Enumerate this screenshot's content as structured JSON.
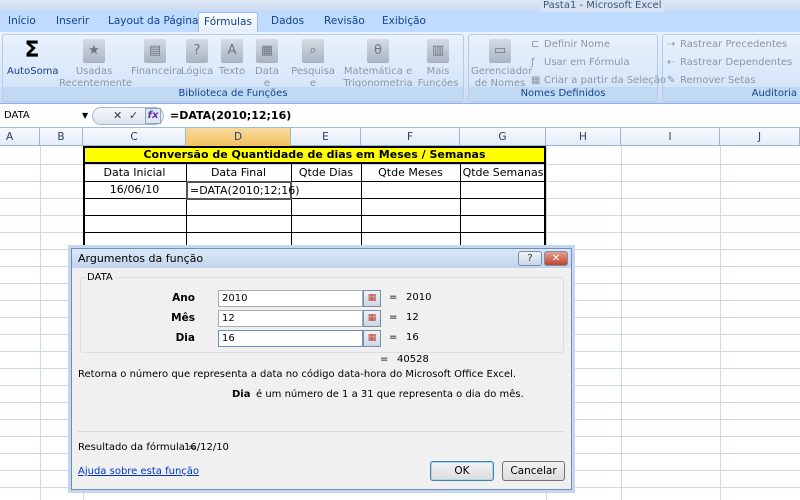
{
  "window": {
    "title": "Pasta1 - Microsoft Excel"
  },
  "tabs": [
    {
      "label": "Início"
    },
    {
      "label": "Inserir"
    },
    {
      "label": "Layout da Página"
    },
    {
      "label": "Fórmulas",
      "active": true
    },
    {
      "label": "Dados"
    },
    {
      "label": "Revisão"
    },
    {
      "label": "Exibição"
    }
  ],
  "ribbon": {
    "biblioteca": {
      "label": "Biblioteca de Funções",
      "buttons": [
        {
          "label": "AutoSoma",
          "icon": "sigma-icon"
        },
        {
          "label": "Usadas Recentemente",
          "icon": "book-star-icon"
        },
        {
          "label": "Financeira",
          "icon": "book-icon"
        },
        {
          "label": "Lógica",
          "icon": "book-question-icon"
        },
        {
          "label": "Texto",
          "icon": "book-a-icon"
        },
        {
          "label": "Data e Hora",
          "icon": "book-calendar-icon"
        },
        {
          "label": "Pesquisa e Referência",
          "icon": "book-magnifier-icon"
        },
        {
          "label": "Matemática e Trigonometria",
          "icon": "book-theta-icon"
        },
        {
          "label": "Mais Funções",
          "icon": "books-icon"
        }
      ]
    },
    "nomes": {
      "label": "Nomes Definidos",
      "gerenciador": "Gerenciador de Nomes",
      "definir": "Definir Nome",
      "usar": "Usar em Fórmula",
      "criar": "Criar a partir da Seleção"
    },
    "auditoria": {
      "label": "Auditoria",
      "precedentes": "Rastrear Precedentes",
      "dependentes": "Rastrear Dependentes",
      "remover": "Remover Setas"
    }
  },
  "formula_bar": {
    "name_box": "DATA",
    "formula": "=DATA(2010;12;16)",
    "fx": "fx"
  },
  "columns": [
    "A",
    "B",
    "C",
    "D",
    "E",
    "F",
    "G",
    "H",
    "I",
    "J"
  ],
  "sheet": {
    "title": "Conversão de Quantidade de dias em Meses / Semanas",
    "headers": [
      "Data Inicial",
      "Data Final",
      "Qtde Dias",
      "Qtde Meses",
      "Qtde Semanas"
    ],
    "row1": [
      "16/06/10",
      "=DATA(2010;12;16)",
      "",
      "",
      ""
    ]
  },
  "dialog": {
    "title": "Argumentos da função",
    "function_name": "DATA",
    "args": [
      {
        "label": "Ano",
        "value": "2010",
        "result": "2010"
      },
      {
        "label": "Mês",
        "value": "12",
        "result": "12"
      },
      {
        "label": "Dia",
        "value": "16",
        "result": "16"
      }
    ],
    "total_result": "40528",
    "description": "Retorna o número que representa a data no código data-hora do Microsoft Office Excel.",
    "arg_name": "Dia",
    "arg_description": "é um número de 1 a 31 que representa o dia do mês.",
    "result_label": "Resultado da fórmula =",
    "result_value": "16/12/10",
    "help_link": "Ajuda sobre esta função",
    "ok": "OK",
    "cancel": "Cancelar",
    "eq": "="
  }
}
